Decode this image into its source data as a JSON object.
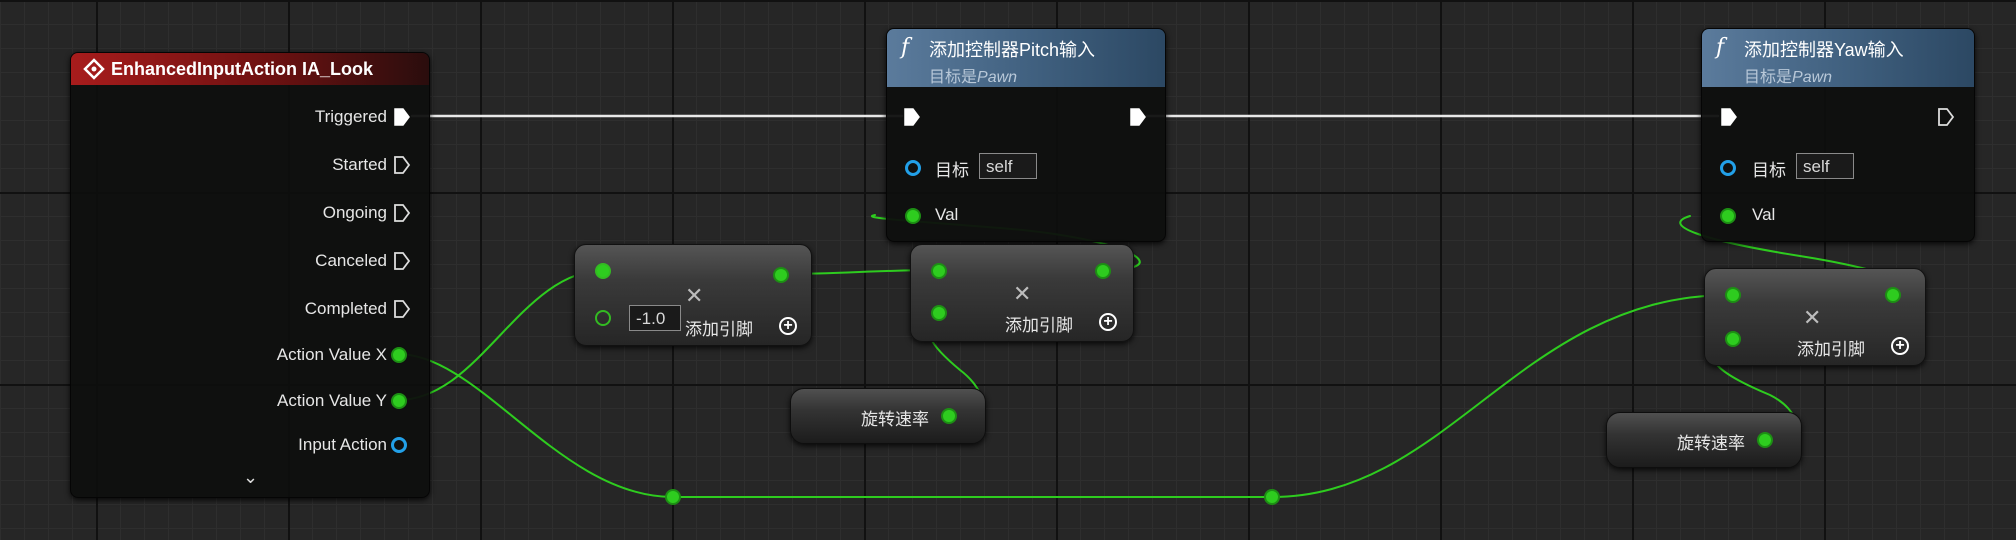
{
  "event_node": {
    "title": "EnhancedInputAction IA_Look",
    "pins": [
      "Triggered",
      "Started",
      "Ongoing",
      "Canceled",
      "Completed",
      "Action Value X",
      "Action Value Y",
      "Input Action"
    ],
    "expand_icon": "chevron-down-icon"
  },
  "pitch_node": {
    "title": "添加控制器Pitch输入",
    "subtitle_prefix": "目标是",
    "subtitle_target": "Pawn",
    "target_label": "目标",
    "target_value": "self",
    "val_label": "Val",
    "icon": "function-icon"
  },
  "yaw_node": {
    "title": "添加控制器Yaw输入",
    "subtitle_prefix": "目标是",
    "subtitle_target": "Pawn",
    "target_label": "目标",
    "target_value": "self",
    "val_label": "Val",
    "icon": "function-icon"
  },
  "multiply_nodes": [
    {
      "input_value": "-1.0",
      "add_pin_label": "添加引脚",
      "op_icon": "multiply-icon"
    },
    {
      "add_pin_label": "添加引脚",
      "op_icon": "multiply-icon"
    },
    {
      "add_pin_label": "添加引脚",
      "op_icon": "multiply-icon"
    }
  ],
  "getters": [
    {
      "label": "旋转速率"
    },
    {
      "label": "旋转速率"
    }
  ],
  "colors": {
    "exec_wire": "#ffffff",
    "float_wire": "#2ecc1f",
    "object_pin": "#22a0e8",
    "event_header": "#a81c1c",
    "function_header": "#4f6f8f"
  }
}
